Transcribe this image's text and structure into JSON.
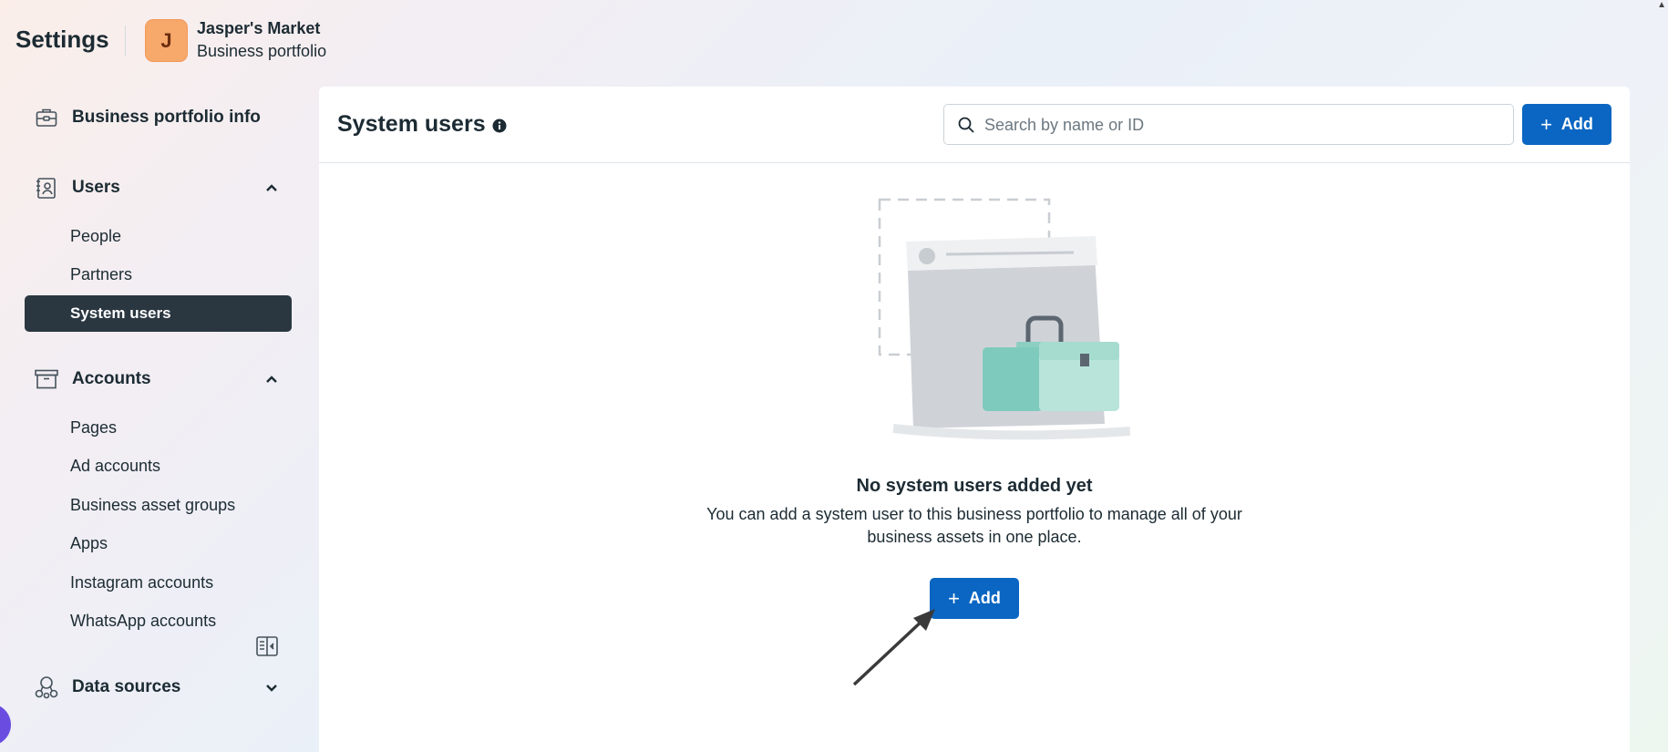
{
  "header": {
    "title": "Settings",
    "avatar_letter": "J",
    "portfolio_name": "Jasper's Market",
    "portfolio_type": "Business portfolio"
  },
  "sidebar": {
    "business_info": "Business portfolio info",
    "users": {
      "label": "Users",
      "items": [
        "People",
        "Partners",
        "System users"
      ],
      "active": "System users"
    },
    "accounts": {
      "label": "Accounts",
      "items": [
        "Pages",
        "Ad accounts",
        "Business asset groups",
        "Apps",
        "Instagram accounts",
        "WhatsApp accounts"
      ]
    },
    "data_sources": {
      "label": "Data sources"
    }
  },
  "main": {
    "title": "System users",
    "search_placeholder": "Search by name or ID",
    "add_label": "Add",
    "empty_title": "No system users added yet",
    "empty_description": "You can add a system user to this business portfolio to manage all of your business assets in one place.",
    "empty_add_label": "Add"
  },
  "colors": {
    "primary_button": "#0a66c2",
    "active_nav_bg": "#2a3741",
    "avatar_bg": "#f7a86b"
  }
}
